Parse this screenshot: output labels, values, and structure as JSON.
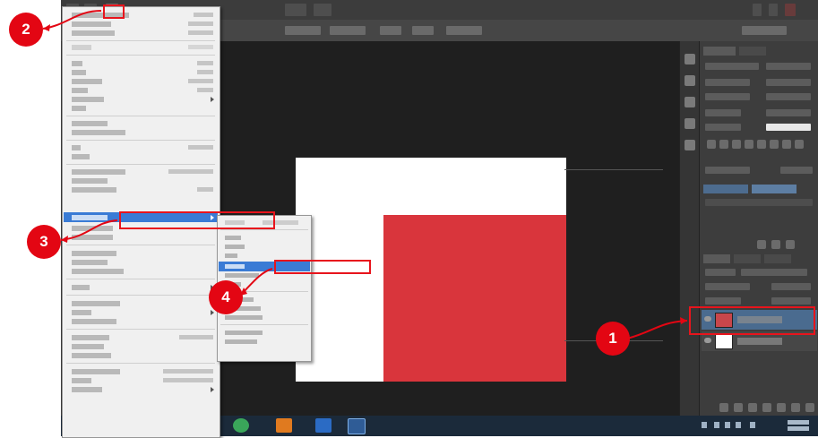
{
  "annotations": {
    "badge_1": "1",
    "badge_2": "2",
    "badge_3": "3",
    "badge_4": "4",
    "color": "#e30613"
  },
  "icons": {
    "start": "windows-start-icon",
    "taskbar": [
      "file-explorer-icon",
      "media-player-icon",
      "firefox-icon",
      "visual-studio-icon",
      "chrome-icon",
      "illustrator-icon",
      "word-icon",
      "photoshop-icon"
    ]
  },
  "colors": {
    "workspace": "#2b2b2b",
    "canvas_red": "#d9353c",
    "menu_highlight": "#3a7bd5"
  }
}
